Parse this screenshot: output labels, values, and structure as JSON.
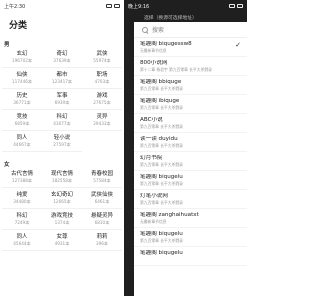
{
  "left": {
    "status_time": "上午2:30",
    "title": "分类",
    "sections": [
      {
        "label": "男",
        "items": [
          {
            "name": "玄幻",
            "count": "196702本"
          },
          {
            "name": "奇幻",
            "count": "37639本"
          },
          {
            "name": "武侠",
            "count": "55974本"
          },
          {
            "name": "仙侠",
            "count": "117446本"
          },
          {
            "name": "都市",
            "count": "123417本"
          },
          {
            "name": "职场",
            "count": "4703本"
          },
          {
            "name": "历史",
            "count": "36771本"
          },
          {
            "name": "军事",
            "count": "6939本"
          },
          {
            "name": "游戏",
            "count": "27675本"
          },
          {
            "name": "竞技",
            "count": "6859本"
          },
          {
            "name": "科幻",
            "count": "43077本"
          },
          {
            "name": "灵异",
            "count": "29433本"
          },
          {
            "name": "同人",
            "count": "44667本"
          },
          {
            "name": "轻小说",
            "count": "27597本"
          }
        ]
      },
      {
        "label": "女",
        "items": [
          {
            "name": "古代言情",
            "count": "127388本"
          },
          {
            "name": "现代言情",
            "count": "182558本"
          },
          {
            "name": "青春校园",
            "count": "57584本"
          },
          {
            "name": "纯爱",
            "count": "34480本"
          },
          {
            "name": "玄幻奇幻",
            "count": "12665本"
          },
          {
            "name": "武侠仙侠",
            "count": "6461本"
          },
          {
            "name": "科幻",
            "count": "7249本"
          },
          {
            "name": "游戏竞技",
            "count": "1374本"
          },
          {
            "name": "悬疑灵异",
            "count": "6810本"
          },
          {
            "name": "同人",
            "count": "45644本"
          },
          {
            "name": "女尊",
            "count": "4931本"
          },
          {
            "name": "莉莉",
            "count": "396本"
          }
        ]
      }
    ]
  },
  "right": {
    "status_time": "晚上9:16",
    "header_text": "选择（换源可选择地址）",
    "search_placeholder": "搜索",
    "sources": [
      {
        "name": "笔趣阁 biqugessw8",
        "sub": "无最新章节信息",
        "selected": true
      },
      {
        "name": "800小说网",
        "sub": "第十二章 杨君宇 第九百零章 长平大杀戮录",
        "selected": false
      },
      {
        "name": "笔趣阁 bbiquge",
        "sub": "第九百零章 长平大杀戮录",
        "selected": false
      },
      {
        "name": "笔趣阁 ibiquge",
        "sub": "第九百零章 长平大杀戮录",
        "selected": false
      },
      {
        "name": "ABC小说",
        "sub": "第九百零章 长平大杀戮录",
        "selected": false
      },
      {
        "name": "读一读 duyidu",
        "sub": "第九百零章 长平大杀戮录",
        "selected": false
      },
      {
        "name": "幻月书院",
        "sub": "第九百零章 长平大杀戮录",
        "selected": false
      },
      {
        "name": "笔趣阁 biqugelu",
        "sub": "第九百零章 长平大杀戮录",
        "selected": false
      },
      {
        "name": "灯笔小说网",
        "sub": "第九百零章 长平大杀戮录",
        "selected": false
      },
      {
        "name": "笔趣阁 zanghaihuatxt",
        "sub": "无最新章节信息",
        "selected": false
      },
      {
        "name": "笔趣阁 biqugelu",
        "sub": "第九百零章 长平大杀戮录",
        "selected": false
      },
      {
        "name": "笔趣阁 biqugelu",
        "sub": "",
        "selected": false
      }
    ]
  }
}
